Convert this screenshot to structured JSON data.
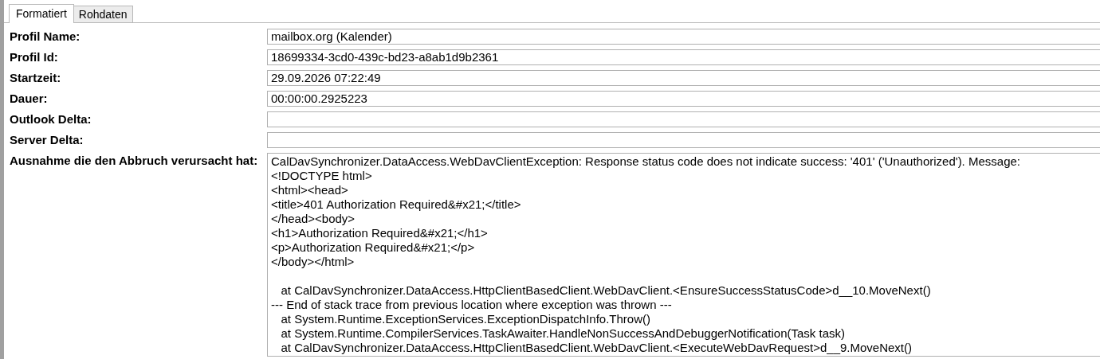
{
  "tabs": [
    {
      "label": "Formatiert",
      "selected": true
    },
    {
      "label": "Rohdaten",
      "selected": false
    }
  ],
  "fields": [
    {
      "label": "Profil Name:",
      "value": "mailbox.org (Kalender)",
      "kind": "line"
    },
    {
      "label": "Profil Id:",
      "value": "18699334-3cd0-439c-bd23-a8ab1d9b2361",
      "kind": "line"
    },
    {
      "label": "Startzeit:",
      "value": "29.09.2026 07:22:49",
      "kind": "line"
    },
    {
      "label": "Dauer:",
      "value": "00:00:00.2925223",
      "kind": "line"
    },
    {
      "label": "Outlook Delta:",
      "kind": "line"
    },
    {
      "label": "Server Delta:",
      "kind": "line"
    },
    {
      "label": "Ausnahme die den Abbruch verursacht hat:",
      "kind": "multiline",
      "value": "CalDavSynchronizer.DataAccess.WebDavClientException: Response status code does not indicate success: '401' ('Unauthorized'). Message: \n<!DOCTYPE html>\n<html><head>\n<title>401 Authorization Required&#x21;</title>\n</head><body>\n<h1>Authorization Required&#x21;</h1>\n<p>Authorization Required&#x21;</p>\n</body></html>\n\n   at CalDavSynchronizer.DataAccess.HttpClientBasedClient.WebDavClient.<EnsureSuccessStatusCode>d__10.MoveNext()\n--- End of stack trace from previous location where exception was thrown ---\n   at System.Runtime.ExceptionServices.ExceptionDispatchInfo.Throw()\n   at System.Runtime.CompilerServices.TaskAwaiter.HandleNonSuccessAndDebuggerNotification(Task task)\n   at CalDavSynchronizer.DataAccess.HttpClientBasedClient.WebDavClient.<ExecuteWebDavRequest>d__9.MoveNext()"
    }
  ]
}
